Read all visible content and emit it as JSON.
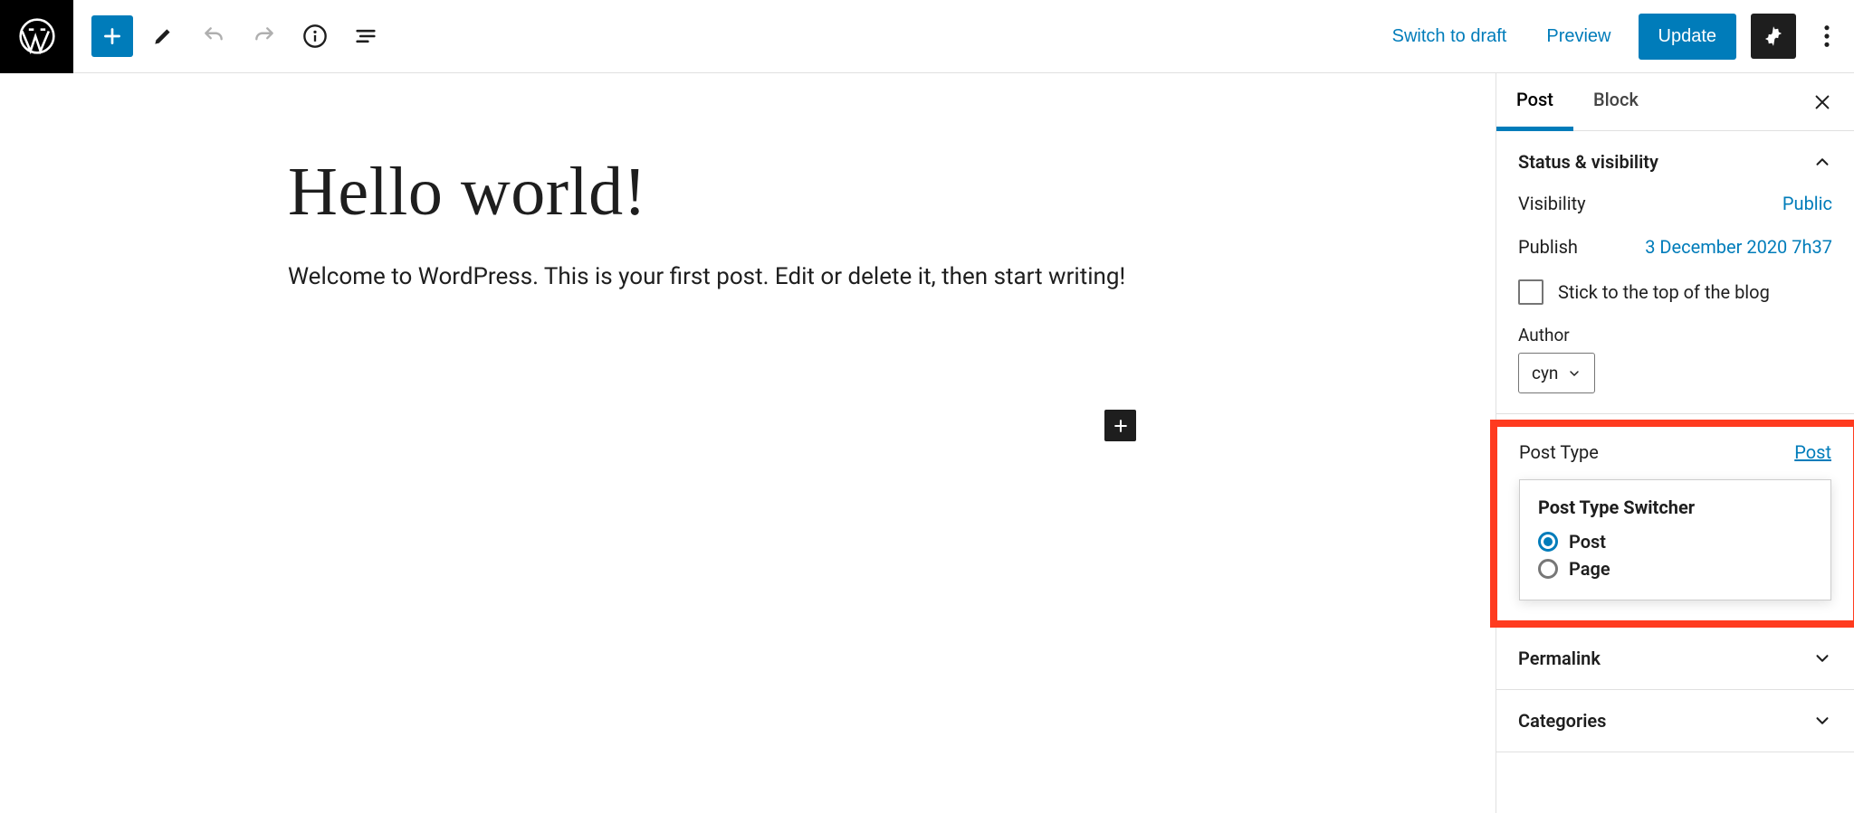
{
  "toolbar": {
    "switch_draft": "Switch to draft",
    "preview": "Preview",
    "update": "Update"
  },
  "post": {
    "title": "Hello world!",
    "content": "Welcome to WordPress. This is your first post. Edit or delete it, then start writing!"
  },
  "sidebar": {
    "tabs": {
      "post": "Post",
      "block": "Block"
    },
    "status_panel": {
      "title": "Status & visibility",
      "visibility_label": "Visibility",
      "visibility_value": "Public",
      "publish_label": "Publish",
      "publish_value": "3 December 2020 7h37",
      "stick_label": "Stick to the top of the blog",
      "author_label": "Author",
      "author_value": "cyn"
    },
    "post_type": {
      "heading": "Post Type",
      "current_link": "Post",
      "switcher_title": "Post Type Switcher",
      "option_post": "Post",
      "option_page": "Page"
    },
    "permalink_title": "Permalink",
    "categories_title": "Categories"
  }
}
